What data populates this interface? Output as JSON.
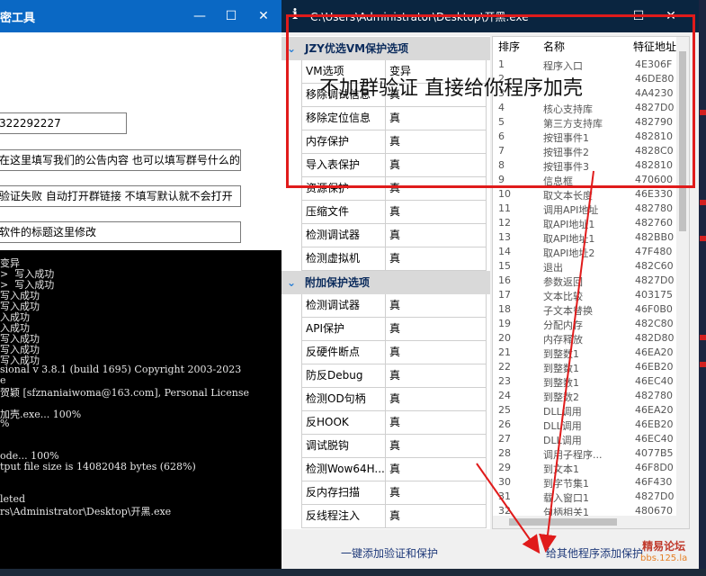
{
  "left_window": {
    "title": "密工具",
    "minimize": "—",
    "maximize": "☐",
    "close": "✕",
    "inputs": [
      {
        "value": "322292227"
      },
      {
        "value": "在这里填写我们的公告内容   也可以填写群号什么的"
      },
      {
        "value": "验证失败 自动打开群链接 不填写默认就不会打开"
      },
      {
        "value": "软件的标题这里修改"
      }
    ],
    "console_lines": [
      "变异",
      ">  写入成功",
      ">  写入成功",
      "写入成功",
      "写入成功",
      "入成功",
      "入成功",
      "写入成功",
      "写入成功",
      "写入成功",
      "sional v 3.8.1 (build 1695) Copyright 2003-2023",
      "e",
      "贺颖 [sfznaniaiwoma@163.com], Personal License",
      "",
      "加壳.exe... 100%",
      "%",
      "",
      "",
      "ode... 100%",
      "tput file size is 14082048 bytes (628%)",
      "",
      "",
      "leted",
      "rs\\Administrator\\Desktop\\开黑.exe"
    ]
  },
  "right_window": {
    "title_icon": "i",
    "title": "C:\\Users\\Administrator\\Desktop\\开黑.exe",
    "maximize": "☐",
    "close": "✕",
    "groups": [
      {
        "label": "JZY优选VM保护选项",
        "chevron": "⌄",
        "options": [
          {
            "name": "VM选项",
            "value": "变异"
          },
          {
            "name": "移除调试信息",
            "value": "真"
          },
          {
            "name": "移除定位信息",
            "value": "真"
          },
          {
            "name": "内存保护",
            "value": "真"
          },
          {
            "name": "导入表保护",
            "value": "真"
          },
          {
            "name": "资源保护",
            "value": "真"
          },
          {
            "name": "压缩文件",
            "value": "真"
          },
          {
            "name": "检测调试器",
            "value": "真"
          },
          {
            "name": "检测虚拟机",
            "value": "真"
          }
        ]
      },
      {
        "label": "附加保护选项",
        "chevron": "⌄",
        "options": [
          {
            "name": "检测调试器",
            "value": "真"
          },
          {
            "name": "API保护",
            "value": "真"
          },
          {
            "name": "反硬件断点",
            "value": "真"
          },
          {
            "name": "防反Debug",
            "value": "真"
          },
          {
            "name": "检测OD句柄",
            "value": "真"
          },
          {
            "name": "反HOOK",
            "value": "真"
          },
          {
            "name": "调试脱钩",
            "value": "真"
          },
          {
            "name": "检测Wow64H...",
            "value": "真"
          },
          {
            "name": "反内存扫描",
            "value": "真"
          },
          {
            "name": "反线程注入",
            "value": "真"
          }
        ]
      }
    ],
    "list_headers": {
      "no": "排序",
      "name": "名称",
      "addr": "特征地址"
    },
    "list_rows": [
      {
        "no": "1",
        "name": "程序入口",
        "addr": "4E306F"
      },
      {
        "no": "2",
        "name": "",
        "addr": "46DE80"
      },
      {
        "no": "3",
        "name": "",
        "addr": "4A4230"
      },
      {
        "no": "4",
        "name": "核心支持库",
        "addr": "4827D0"
      },
      {
        "no": "5",
        "name": "第三方支持库",
        "addr": "482790"
      },
      {
        "no": "6",
        "name": "按钮事件1",
        "addr": "482810"
      },
      {
        "no": "7",
        "name": "按钮事件2",
        "addr": "4828C0"
      },
      {
        "no": "8",
        "name": "按钮事件3",
        "addr": "482810"
      },
      {
        "no": "9",
        "name": "信息框",
        "addr": "470600"
      },
      {
        "no": "10",
        "name": "取文本长度",
        "addr": "46E330"
      },
      {
        "no": "11",
        "name": "调用API地址",
        "addr": "482780"
      },
      {
        "no": "12",
        "name": "取API地址1",
        "addr": "482760"
      },
      {
        "no": "13",
        "name": "取API地址1",
        "addr": "482BB0"
      },
      {
        "no": "14",
        "name": "取API地址2",
        "addr": "47F480"
      },
      {
        "no": "15",
        "name": "退出",
        "addr": "482C60"
      },
      {
        "no": "16",
        "name": "参数返回",
        "addr": "4827D0"
      },
      {
        "no": "17",
        "name": "文本比较",
        "addr": "403175"
      },
      {
        "no": "18",
        "name": "子文本替换",
        "addr": "46F0B0"
      },
      {
        "no": "19",
        "name": "分配内存",
        "addr": "482C80"
      },
      {
        "no": "20",
        "name": "内存释放",
        "addr": "482D80"
      },
      {
        "no": "21",
        "name": "到整数1",
        "addr": "46EA20"
      },
      {
        "no": "22",
        "name": "到整数1",
        "addr": "46EB20"
      },
      {
        "no": "23",
        "name": "到整数1",
        "addr": "46EC40"
      },
      {
        "no": "24",
        "name": "到整数2",
        "addr": "482780"
      },
      {
        "no": "25",
        "name": "DLL调用",
        "addr": "46EA20"
      },
      {
        "no": "26",
        "name": "DLL调用",
        "addr": "46EB20"
      },
      {
        "no": "27",
        "name": "DLL调用",
        "addr": "46EC40"
      },
      {
        "no": "28",
        "name": "调用子程序...",
        "addr": "4077B5"
      },
      {
        "no": "29",
        "name": "到文本1",
        "addr": "46F8D0"
      },
      {
        "no": "30",
        "name": "到字节集1",
        "addr": "46F430"
      },
      {
        "no": "31",
        "name": "载入窗口1",
        "addr": "4827D0"
      },
      {
        "no": "32",
        "name": "句柄相关1",
        "addr": "480670"
      }
    ],
    "bottom_left_label": "一键添加验证和保护",
    "bottom_right_label": "给其他程序添加保护"
  },
  "annotation": {
    "text": "不加群验证 直接给你程序加壳",
    "color": "#e01b1b"
  },
  "watermark": {
    "line1": "精易论坛",
    "line2": "bbs.125.la"
  }
}
